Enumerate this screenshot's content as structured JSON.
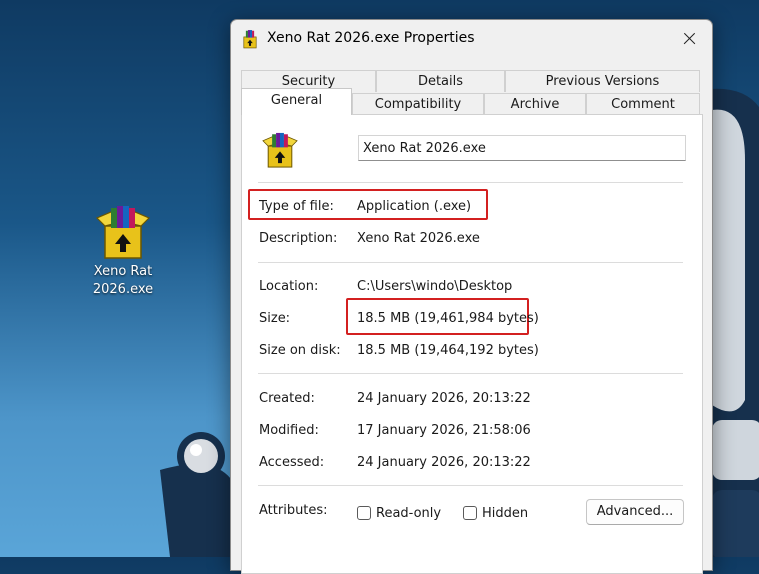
{
  "desktop": {
    "icon_label_line1": "Xeno Rat",
    "icon_label_line2": "2026.exe",
    "icon": "winrar-archive-icon"
  },
  "dialog": {
    "title": "Xeno Rat 2026.exe Properties",
    "tabs_row1": [
      "Security",
      "Details",
      "Previous Versions"
    ],
    "tabs_row2": [
      "General",
      "Compatibility",
      "Archive",
      "Comment"
    ],
    "active_tab": "General",
    "file_name_value": "Xeno Rat 2026.exe",
    "fields": {
      "type_label": "Type of file:",
      "type_value": "Application (.exe)",
      "description_label": "Description:",
      "description_value": "Xeno Rat 2026.exe",
      "location_label": "Location:",
      "location_value": "C:\\Users\\windo\\Desktop",
      "size_label": "Size:",
      "size_value": "18.5 MB (19,461,984 bytes)",
      "size_on_disk_label": "Size on disk:",
      "size_on_disk_value": "18.5 MB (19,464,192 bytes)",
      "created_label": "Created:",
      "created_value": "24 January 2026, 20:13:22",
      "modified_label": "Modified:",
      "modified_value": "17 January 2026, 21:58:06",
      "accessed_label": "Accessed:",
      "accessed_value": "24 January 2026, 20:13:22",
      "attributes_label": "Attributes:"
    },
    "attributes": {
      "readonly_label": "Read-only",
      "readonly_checked": false,
      "hidden_label": "Hidden",
      "hidden_checked": false,
      "advanced_label": "Advanced..."
    },
    "highlight_color": "#d32020"
  }
}
